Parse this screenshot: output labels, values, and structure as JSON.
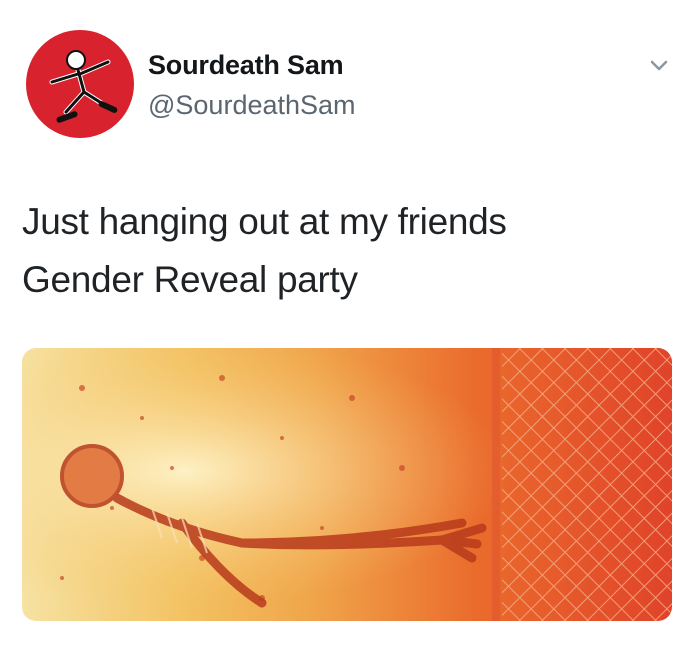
{
  "tweet": {
    "author_name": "Sourdeath Sam",
    "author_handle": "@SourdeathSam",
    "text_lines": [
      "Just hanging out at my friends",
      "Gender Reveal party"
    ],
    "avatar_icon": "skeleton-skater-icon",
    "menu_icon": "chevron-down-icon",
    "media_icon": "skeleton-fence-explosion-image"
  },
  "colors": {
    "avatar_bg": "#d8232e",
    "handle": "#5b6670",
    "text": "#1f2326"
  }
}
